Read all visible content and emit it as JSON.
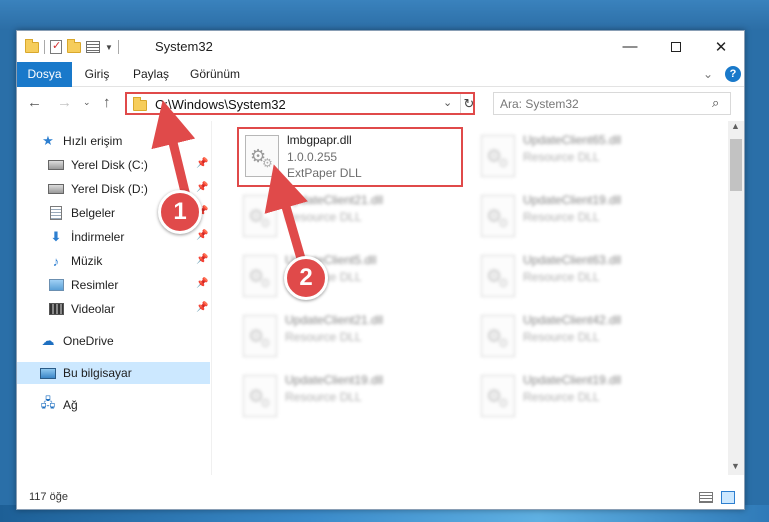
{
  "window": {
    "title": "System32",
    "minimize": "—",
    "close": "✕"
  },
  "ribbon": {
    "tabs": [
      "Dosya",
      "Giriş",
      "Paylaş",
      "Görünüm"
    ],
    "expand": "⌄",
    "help": "?"
  },
  "nav": {
    "back": "←",
    "forward": "→",
    "recent": "⌄",
    "up": "↑",
    "address": "C:\\Windows\\System32",
    "address_dropdown": "⌄",
    "refresh": "↻",
    "search_placeholder": "Ara: System32",
    "search_icon": "⌕"
  },
  "sidebar": {
    "items": [
      {
        "label": "Hızlı erişim",
        "icon": "star-icon",
        "pinned": false
      },
      {
        "label": "Yerel Disk (C:)",
        "icon": "drive-icon",
        "pinned": true
      },
      {
        "label": "Yerel Disk (D:)",
        "icon": "drive-icon",
        "pinned": true
      },
      {
        "label": "Belgeler",
        "icon": "documents-icon",
        "pinned": true
      },
      {
        "label": "İndirmeler",
        "icon": "download-icon",
        "pinned": true
      },
      {
        "label": "Müzik",
        "icon": "music-icon",
        "pinned": true
      },
      {
        "label": "Resimler",
        "icon": "pictures-icon",
        "pinned": true
      },
      {
        "label": "Videolar",
        "icon": "videos-icon",
        "pinned": true
      },
      {
        "label": "OneDrive",
        "icon": "cloud-icon",
        "pinned": false
      },
      {
        "label": "Bu bilgisayar",
        "icon": "computer-icon",
        "pinned": false,
        "selected": true
      },
      {
        "label": "Ağ",
        "icon": "network-icon",
        "pinned": false
      }
    ],
    "pin_glyph": "📌"
  },
  "files": {
    "highlighted": {
      "name": "lmbgpapr.dll",
      "version": "1.0.0.255",
      "description": "ExtPaper DLL"
    },
    "blurred": [
      {
        "name": "UpdateClient65.dll",
        "description": "Resource DLL"
      },
      {
        "name": "UpdateClient21.dll",
        "description": "Resource DLL"
      },
      {
        "name": "UpdateClient19.dll",
        "description": "Resource DLL"
      },
      {
        "name": "UpdateClient5.dll",
        "description": "Resource DLL"
      },
      {
        "name": "UpdateClient63.dll",
        "description": "Resource DLL"
      },
      {
        "name": "UpdateClient21.dll",
        "description": "Resource DLL"
      },
      {
        "name": "UpdateClient42.dll",
        "description": "Resource DLL"
      },
      {
        "name": "UpdateClient19.dll",
        "description": "Resource DLL"
      },
      {
        "name": "UpdateClient19.dll",
        "description": "Resource DLL"
      }
    ]
  },
  "scrollbar": {
    "up": "▲",
    "down": "▼"
  },
  "status": {
    "item_count": "117 öğe"
  },
  "annotations": {
    "step1": "1",
    "step2": "2",
    "color": "#e04a4a"
  }
}
